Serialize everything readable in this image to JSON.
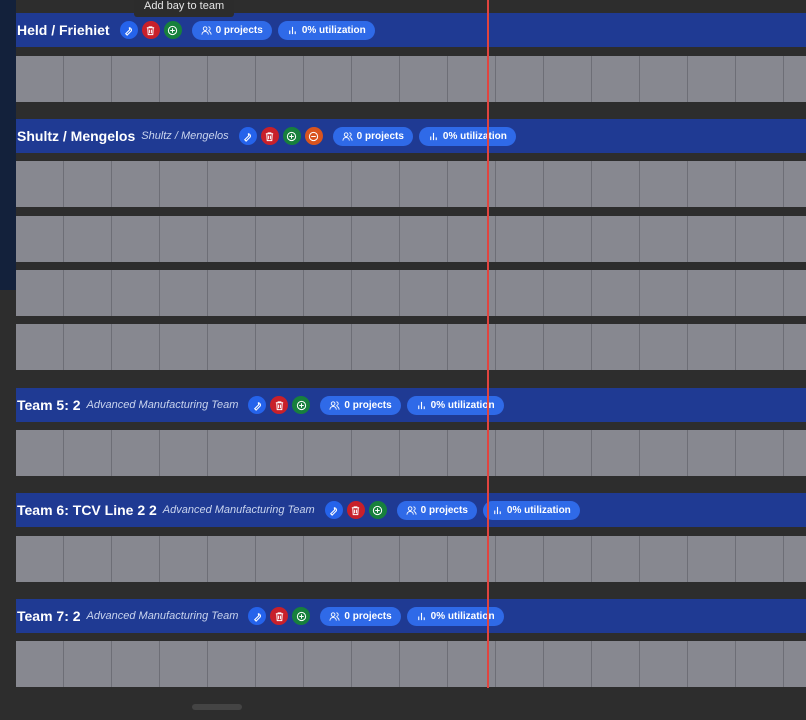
{
  "tooltip": "Add bay to team",
  "teams": [
    {
      "name": "Held / Friehiet",
      "subtitle": "",
      "projects": "0 projects",
      "utilization": "0% utilization",
      "actions": [
        "wrench-icon",
        "trash-icon",
        "plus-circle-icon"
      ]
    },
    {
      "name": "Shultz / Mengelos",
      "subtitle": "Shultz / Mengelos",
      "projects": "0 projects",
      "utilization": "0% utilization",
      "actions": [
        "wrench-icon",
        "trash-icon",
        "plus-circle-icon",
        "minus-circle-icon"
      ]
    },
    {
      "name": "Team 5: 2",
      "subtitle": "Advanced Manufacturing Team",
      "projects": "0 projects",
      "utilization": "0% utilization",
      "actions": [
        "wrench-icon",
        "trash-icon",
        "plus-circle-icon"
      ]
    },
    {
      "name": "Team 6: TCV Line 2 2",
      "subtitle": "Advanced Manufacturing Team",
      "projects": "0 projects",
      "utilization": "0% utilization",
      "actions": [
        "wrench-icon",
        "trash-icon",
        "plus-circle-icon"
      ]
    },
    {
      "name": "Team 7: 2",
      "subtitle": "Advanced Manufacturing Team",
      "projects": "0 projects",
      "utilization": "0% utilization",
      "actions": [
        "wrench-icon",
        "trash-icon",
        "plus-circle-icon"
      ]
    }
  ],
  "colors": {
    "header": "#1f3a93",
    "bay": "#878890",
    "timeline_marker": "#e0443f",
    "background": "#2d2d2d"
  }
}
